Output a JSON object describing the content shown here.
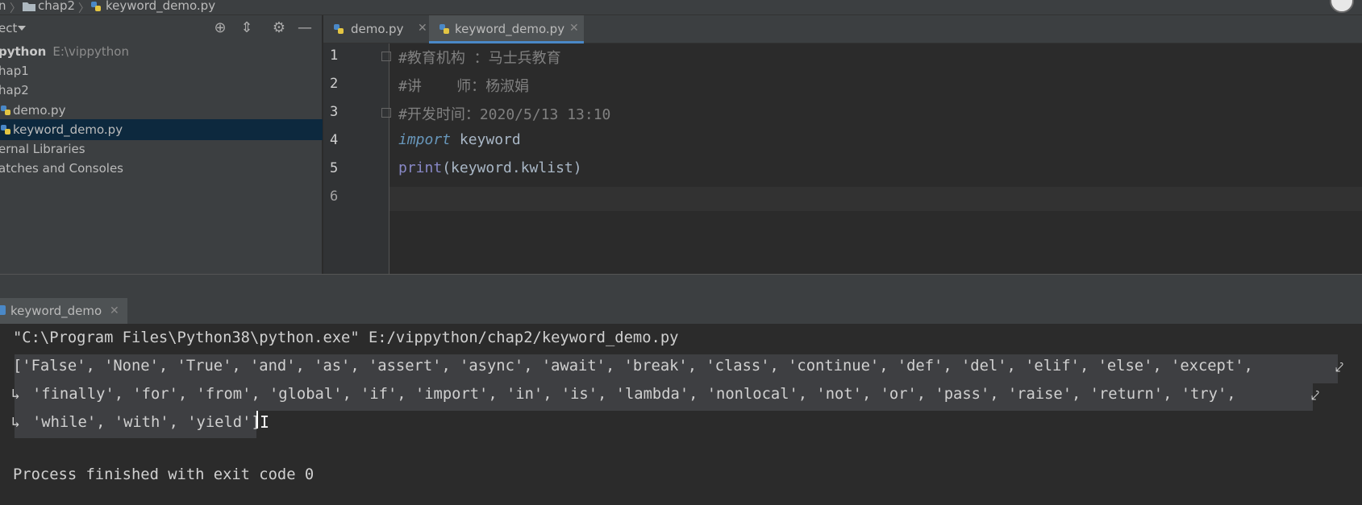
{
  "breadcrumb": {
    "items": [
      "n",
      "chap2",
      "keyword_demo.py"
    ]
  },
  "project_panel": {
    "title": "ect",
    "tree": [
      {
        "name": "python",
        "path": "E:\\vippython",
        "selected": false
      },
      {
        "name": "hap1",
        "selected": false
      },
      {
        "name": "hap2",
        "selected": false
      },
      {
        "name": "demo.py",
        "selected": false
      },
      {
        "name": "keyword_demo.py",
        "selected": true
      },
      {
        "name": "ernal Libraries",
        "selected": false
      },
      {
        "name": "atches and Consoles",
        "selected": false
      }
    ]
  },
  "editor": {
    "tabs": [
      {
        "label": "demo.py",
        "active": false
      },
      {
        "label": "keyword_demo.py",
        "active": true
      }
    ],
    "line_numbers": [
      "1",
      "2",
      "3",
      "4",
      "5",
      "6"
    ],
    "lines": {
      "l1": "#教育机构 ：马士兵教育",
      "l2": "#讲    师：杨淑娟",
      "l3": "#开发时间：2020/5/13 13:10",
      "l4_kw": "import",
      "l4_rest": " keyword",
      "l5_fn": "print",
      "l5_rest": "(keyword.kwlist)"
    }
  },
  "run_panel": {
    "tab_label": "keyword_demo",
    "console": {
      "cmd": "\"C:\\Program Files\\Python38\\python.exe\" E:/vippython/chap2/keyword_demo.py",
      "out1": "['False', 'None', 'True', 'and', 'as', 'assert', 'async', 'await', 'break', 'class', 'continue', 'def', 'del', 'elif', 'else', 'except', ",
      "out2": "'finally', 'for', 'from', 'global', 'if', 'import', 'in', 'is', 'lambda', 'nonlocal', 'not', 'or', 'pass', 'raise', 'return', 'try', ",
      "out3": "'while', 'with', 'yield']",
      "exit": "Process finished with exit code 0"
    }
  },
  "colors": {
    "background": "#2b2b2b",
    "panel": "#3c3f41",
    "selection": "#0d293e",
    "accent": "#4a88c7"
  }
}
